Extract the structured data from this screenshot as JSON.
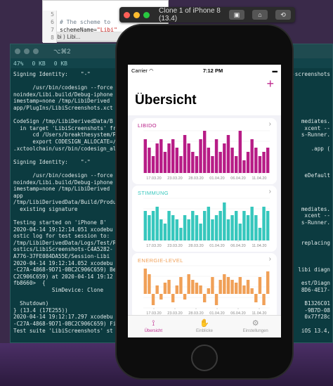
{
  "xcode": {
    "tabbar": "⋮  Libi  ⟩  Libi...",
    "lines": [
      "5",
      "6",
      "7",
      "8"
    ],
    "comment": "# The scheme to ",
    "scheme_key": "schemeName=",
    "scheme_val": "\"Libi\""
  },
  "terminal": {
    "title": "⌥⌘2",
    "status": [
      "47%",
      "0 KB",
      "0 KB"
    ],
    "log": "Signing Identity:    \"-\"\n\n      /usr/bin/codesign --force --\nnoindex/Libi.build/Debug-iphone\nimestamp=none /tmp/LibiDerived\napp/PlugIns/LibiScreenshots.xct\n\nCodeSign /tmp/LibiDerivedData/B\n  in target 'LibiScreenshots' fro\n      cd /Users/breakthesystem/Re\n      export CODESIGN_ALLOCATE=/Ap\n.xctoolchain/usr/bin/codesign_al\n\nSigning Identity:    \"-\"\n\n      /usr/bin/codesign --force --\nnoindex/Libi.build/Debug-iphone\nimestamp=none /tmp/LibiDerived\napp\n/tmp/LibiDerivedData/Build/Produ\n  existing signature\n\nTesting started on 'iPhone 8'\n2020-04-14 19:12:14.051 xcodebu\nostic log for test session to:\n/tmp/LibiDerivedData/Logs/Test/R\nostics/LibiScreenshots-C4A5282-\nA776-37FE084DA55E/Session-Libi\n2020-04-14 19:12:14.052 xcodebu\n-C27A-4868-9D71-0BC2C906C659) Be\nC2C906C659) at 2020-04-14 19:12\nfb8660>  {\n            SimDevice: Clone\n\n  Shutdown)\n} (13.4 (17E255))\n2020-04-14 19:12:17.297 xcodebu\n-C27A-4868-9D71-0BC2C906C659) Fi\nTest suite 'LibiScreenshots' st",
    "right_log": "g-screenshots\n\n\n\n\n\n\nmediates.\nxcent --\ns-Runner.\n\n.app (\n\n\n\neDefault\n\n\n\n\nmediates.\nxcent --\ns-Runner.\n\n\nreplacing\n\n\n\nlibi diagn\n\nest/Diagn\n8D6-4E17-\n\nB1326C01\n-9B7D-08\n0x77f28c\n\niOS 13.4,\n\n\n\nB1326C01\n-9B7D-08\napp (3831"
  },
  "simulator": {
    "title": "Clone 1 of iPhone 8 (13.4)"
  },
  "app": {
    "carrier": "Carrier",
    "time": "7:12 PM",
    "battery": "▬",
    "title": "Übersicht",
    "add_glyph": "+",
    "chevron": "›",
    "tabs": [
      {
        "label": "Übersicht",
        "icon": "⟟",
        "active": true
      },
      {
        "label": "Einblicke",
        "icon": "✋",
        "active": false
      },
      {
        "label": "Einstellungen",
        "icon": "⚙",
        "active": false
      }
    ]
  },
  "chart_data": [
    {
      "type": "bar",
      "title": "LIBIDO",
      "color": "#b71c86",
      "x_ticks": [
        "17.03.20",
        "23.03.20",
        "28.03.20",
        "01.04.20",
        "06.04.20",
        "11.04.20"
      ],
      "values": [
        8,
        6,
        4,
        7,
        8,
        5,
        7,
        8,
        6,
        4,
        9,
        7,
        5,
        4,
        8,
        10,
        6,
        4,
        8,
        5,
        7,
        9,
        6,
        4,
        10,
        3,
        5,
        8,
        6,
        4,
        5,
        6
      ],
      "ylim": [
        0,
        10
      ]
    },
    {
      "type": "bar",
      "title": "STIMMUNG",
      "color": "#36c7bd",
      "x_ticks": [
        "17.03.20",
        "23.03.20",
        "28.03.20",
        "01.04.20",
        "06.04.20",
        "11.04.20"
      ],
      "values": [
        7,
        6,
        7,
        8,
        5,
        4,
        7,
        6,
        5,
        3,
        6,
        5,
        7,
        6,
        4,
        7,
        8,
        5,
        6,
        7,
        9,
        5,
        6,
        7,
        4,
        7,
        6,
        8,
        6,
        3,
        8,
        7
      ],
      "ylim": [
        0,
        10
      ]
    },
    {
      "type": "bar",
      "title": "ENERGIE-LEVEL",
      "color": "#f0a057",
      "x_ticks": [
        "17.03.20",
        "23.03.20",
        "28.03.20",
        "01.04.20",
        "06.04.20",
        "11.04.20"
      ],
      "values": [
        9,
        7,
        -4,
        3,
        -2,
        4,
        5,
        -3,
        3,
        6,
        -2,
        7,
        5,
        4,
        3,
        -3,
        2,
        6,
        -4,
        5,
        7,
        6,
        5,
        4,
        6,
        3,
        5,
        2,
        -3,
        6,
        -4,
        8
      ],
      "ylim": [
        -5,
        10
      ]
    }
  ]
}
